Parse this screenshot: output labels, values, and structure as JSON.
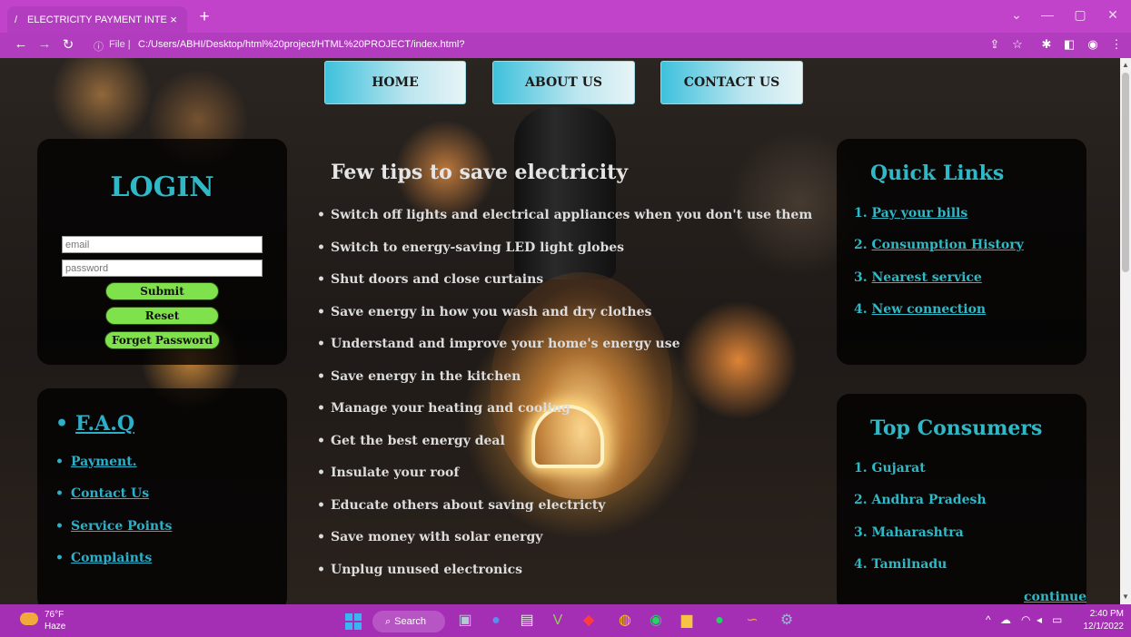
{
  "browser": {
    "tab_title": "ELECTRICITY PAYMENT INTERFAC",
    "tab_favicon": "/",
    "close_glyph": "×",
    "newtab_glyph": "+",
    "url_prefix": "File |",
    "url": "C:/Users/ABHI/Desktop/html%20project/HTML%20PROJECT/index.html?",
    "icons": [
      "back-icon",
      "forward-icon",
      "reload-icon",
      "info-icon",
      "share-icon",
      "star-icon",
      "extensions-icon",
      "sidepanel-icon",
      "profile-icon",
      "menu-icon"
    ]
  },
  "nav": {
    "home": "HOME",
    "about": "ABOUT US",
    "contact": "CONTACT US"
  },
  "login": {
    "title": "LOGIN",
    "email_placeholder": "email",
    "password_placeholder": "password",
    "submit": "Submit",
    "reset": "Reset",
    "forget": "Forget Password"
  },
  "faq": {
    "title": "F.A.Q",
    "bullet": "•",
    "items": [
      "Payment.",
      "Contact Us",
      "Service Points",
      "Complaints"
    ]
  },
  "tips": {
    "title": "Few tips to save electricity",
    "bullet": "•",
    "items": [
      "Switch off lights and electrical appliances when you don't use them",
      "Switch to energy-saving LED light globes",
      "Shut doors and close curtains",
      "Save energy in how you wash and dry clothes",
      "Understand and improve your home's energy use",
      "Save energy in the kitchen",
      "Manage your heating and cooling",
      "Get the best energy deal",
      "Insulate your roof",
      "Educate others about saving electricty",
      "Save money with solar energy",
      "Unplug unused electronics"
    ]
  },
  "quick_links": {
    "title": "Quick Links",
    "items": [
      {
        "num": "1.",
        "label": "Pay your bills"
      },
      {
        "num": "2.",
        "label": "Consumption History"
      },
      {
        "num": "3.",
        "label": "Nearest service"
      },
      {
        "num": "4.",
        "label": "New connection"
      }
    ]
  },
  "top_consumers": {
    "title": "Top Consumers",
    "items": [
      {
        "num": "1.",
        "label": "Gujarat"
      },
      {
        "num": "2.",
        "label": "Andhra Pradesh"
      },
      {
        "num": "3.",
        "label": "Maharashtra"
      },
      {
        "num": "4.",
        "label": "Tamilnadu"
      }
    ],
    "continue": "continue"
  },
  "taskbar": {
    "temperature": "76°F",
    "condition": "Haze",
    "search_label": "Search",
    "time": "2:40 PM",
    "date": "12/1/2022"
  },
  "colors": {
    "accent": "#2fb8c6",
    "button_green": "#7fe24c",
    "titlebar": "#c043c9",
    "taskbar": "#a52fb4"
  }
}
